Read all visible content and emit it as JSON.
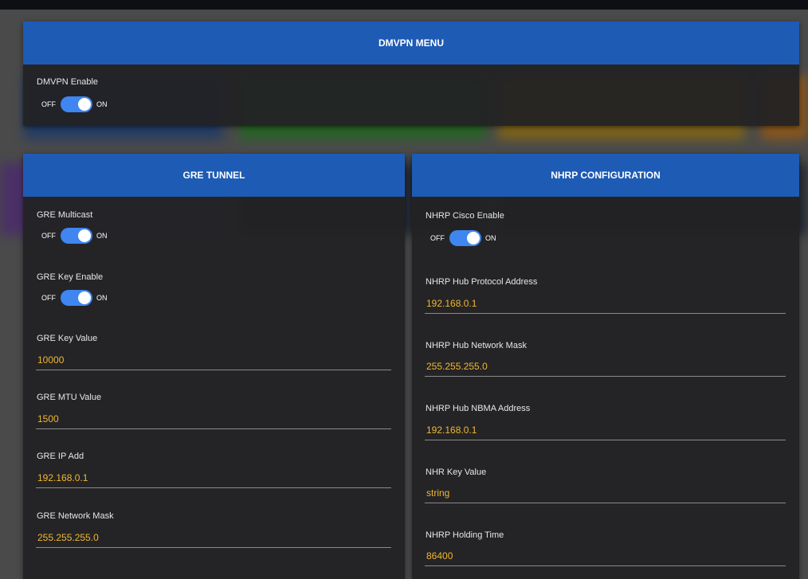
{
  "colors": {
    "header_bg": "#1e5bb5",
    "card_bg": "#232325",
    "toggle_on": "#3f86f0",
    "value_text": "#f2b630"
  },
  "dmvpn_menu": {
    "title": "DMVPN MENU",
    "enable": {
      "label": "DMVPN Enable",
      "off": "OFF",
      "on": "ON",
      "state": true
    }
  },
  "gre_tunnel": {
    "title": "GRE TUNNEL",
    "multicast": {
      "label": "GRE Multicast",
      "off": "OFF",
      "on": "ON",
      "state": true
    },
    "key_enable": {
      "label": "GRE Key Enable",
      "off": "OFF",
      "on": "ON",
      "state": true
    },
    "key_value": {
      "label": "GRE Key Value",
      "value": "10000"
    },
    "mtu_value": {
      "label": "GRE MTU Value",
      "value": "1500"
    },
    "ip_add": {
      "label": "GRE IP Add",
      "value": "192.168.0.1"
    },
    "network_mask": {
      "label": "GRE Network Mask",
      "value": "255.255.255.0"
    }
  },
  "nhrp": {
    "title": "NHRP CONFIGURATION",
    "cisco_enable": {
      "label": "NHRP Cisco Enable",
      "off": "OFF",
      "on": "ON",
      "state": true
    },
    "hub_protocol_address": {
      "label": "NHRP Hub Protocol Address",
      "value": "192.168.0.1"
    },
    "hub_network_mask": {
      "label": "NHRP Hub Network Mask",
      "value": "255.255.255.0"
    },
    "hub_nbma_address": {
      "label": "NHRP Hub NBMA Address",
      "value": "192.168.0.1"
    },
    "key_value": {
      "label": "NHR Key Value",
      "value": "string"
    },
    "holding_time": {
      "label": "NHRP Holding Time",
      "value": "86400"
    }
  }
}
